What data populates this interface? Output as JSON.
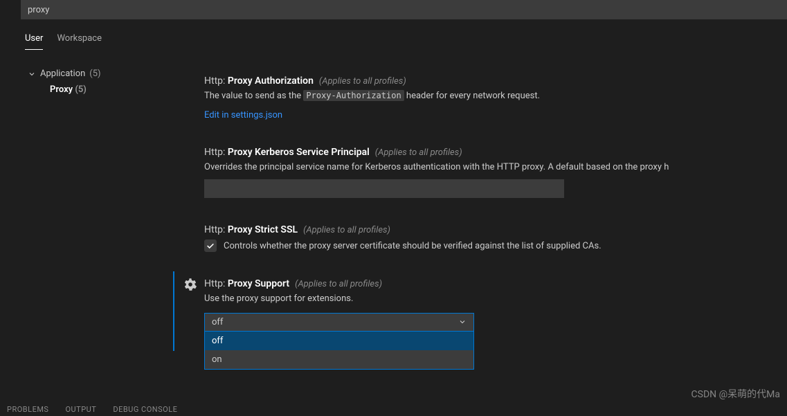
{
  "search": {
    "value": "proxy"
  },
  "scopes": {
    "user": "User",
    "workspace": "Workspace"
  },
  "sidebar": {
    "app": {
      "label": "Application",
      "count": "(5)"
    },
    "proxy": {
      "label": "Proxy",
      "count": "(5)"
    }
  },
  "settings": {
    "proxy_auth": {
      "prefix": "Http:",
      "name": "Proxy Authorization",
      "scope": "(Applies to all profiles)",
      "desc_before": "The value to send as the ",
      "code": "Proxy-Authorization",
      "desc_after": " header for every network request.",
      "link": "Edit in settings.json"
    },
    "kerberos": {
      "prefix": "Http:",
      "name": "Proxy Kerberos Service Principal",
      "scope": "(Applies to all profiles)",
      "desc": "Overrides the principal service name for Kerberos authentication with the HTTP proxy. A default based on the proxy h",
      "value": ""
    },
    "strict_ssl": {
      "prefix": "Http:",
      "name": "Proxy Strict SSL",
      "scope": "(Applies to all profiles)",
      "chk_label": "Controls whether the proxy server certificate should be verified against the list of supplied CAs."
    },
    "support": {
      "prefix": "Http:",
      "name": "Proxy Support",
      "scope": "(Applies to all profiles)",
      "desc": "Use the proxy support for extensions.",
      "selected": "off",
      "options": {
        "off": "off",
        "on": "on"
      }
    }
  },
  "panel": {
    "problems": "PROBLEMS",
    "output": "OUTPUT",
    "debug": "DEBUG CONSOLE"
  },
  "watermark": "CSDN @呆萌的代Ma"
}
